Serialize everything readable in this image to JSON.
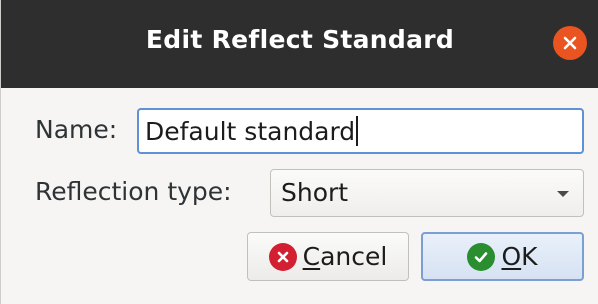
{
  "window": {
    "title": "Edit Reflect Standard",
    "close_icon": "close-icon"
  },
  "form": {
    "name_label": "Name:",
    "name_value": "Default standard",
    "reflection_type_label": "Reflection type:",
    "reflection_type_value": "Short",
    "dropdown_icon": "chevron-down-icon"
  },
  "buttons": {
    "cancel_mnemonic": "C",
    "cancel_rest": "ancel",
    "cancel_icon": "cancel-icon",
    "ok_mnemonic": "O",
    "ok_rest": "K",
    "ok_icon": "checkmark-icon"
  },
  "colors": {
    "titlebar": "#2e2e2e",
    "close_button": "#e95420",
    "focus_border": "#5e91d6",
    "cancel_icon": "#d21f32",
    "ok_icon": "#2a8d2f"
  }
}
